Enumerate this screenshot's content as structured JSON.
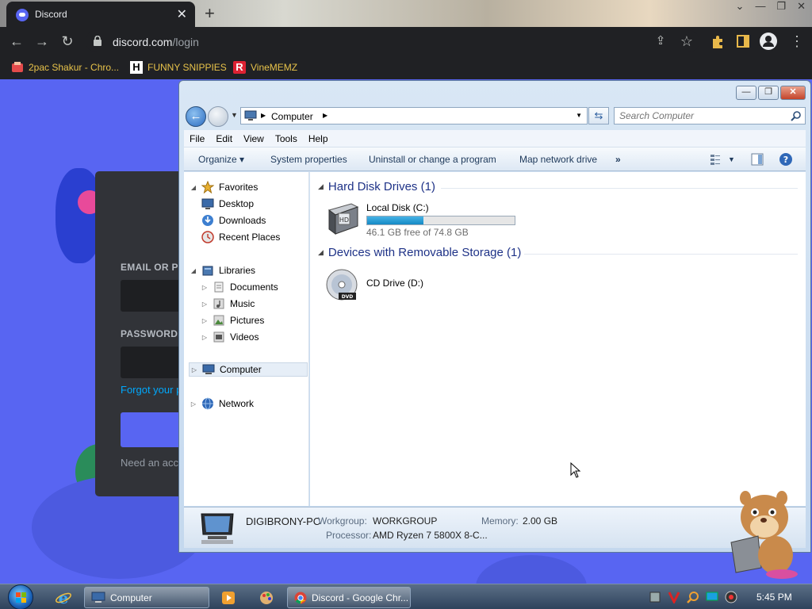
{
  "browser": {
    "tab_title": "Discord",
    "tab_close": "✕",
    "new_tab": "+",
    "window_controls": [
      "⌄",
      "—",
      "❐",
      "✕"
    ],
    "url_host": "discord.com",
    "url_path": "/login",
    "bookmarks": [
      {
        "label": "2pac Shakur - Chro...",
        "icon": "bookmark-red-icon"
      },
      {
        "label": "FUNNY SNIPPIES",
        "icon": "H"
      },
      {
        "label": "VineMEMZ",
        "icon": "R"
      }
    ]
  },
  "discord_login": {
    "email_label": "EMAIL OR PH",
    "password_label": "PASSWORD",
    "forgot_link": "Forgot your p",
    "need_account": "Need an acc"
  },
  "explorer": {
    "caption_buttons": [
      "—",
      "❐",
      "✕"
    ],
    "address_crumb": "Computer",
    "search_placeholder": "Search Computer",
    "menu": [
      "File",
      "Edit",
      "View",
      "Tools",
      "Help"
    ],
    "commands": {
      "organize": "Organize ▾",
      "system_properties": "System properties",
      "uninstall": "Uninstall or change a program",
      "map_drive": "Map network drive",
      "more": "»"
    },
    "nav": {
      "favorites": "Favorites",
      "desktop": "Desktop",
      "downloads": "Downloads",
      "recent_places": "Recent Places",
      "libraries": "Libraries",
      "documents": "Documents",
      "music": "Music",
      "pictures": "Pictures",
      "videos": "Videos",
      "computer": "Computer",
      "network": "Network"
    },
    "groups": {
      "hdd": "Hard Disk Drives (1)",
      "removable": "Devices with Removable Storage (1)"
    },
    "local_disk": {
      "name": "Local Disk (C:)",
      "free_text": "46.1 GB free of 74.8 GB",
      "used_fraction": 0.384
    },
    "cd_drive": {
      "name": "CD Drive (D:)"
    },
    "details": {
      "pc_name": "DIGIBRONY-PC",
      "workgroup_label": "Workgroup:",
      "workgroup_value": "WORKGROUP",
      "memory_label": "Memory:",
      "memory_value": "2.00 GB",
      "processor_label": "Processor:",
      "processor_value": "AMD Ryzen 7 5800X 8-C..."
    }
  },
  "taskbar": {
    "computer_label": "Computer",
    "chrome_label": "Discord - Google Chr...",
    "clock": "5:45 PM"
  },
  "colors": {
    "discord_blurple": "#5865f2",
    "chrome_dark": "#202124",
    "explorer_header": "#1e3287",
    "disk_bar": "#1589c4"
  }
}
